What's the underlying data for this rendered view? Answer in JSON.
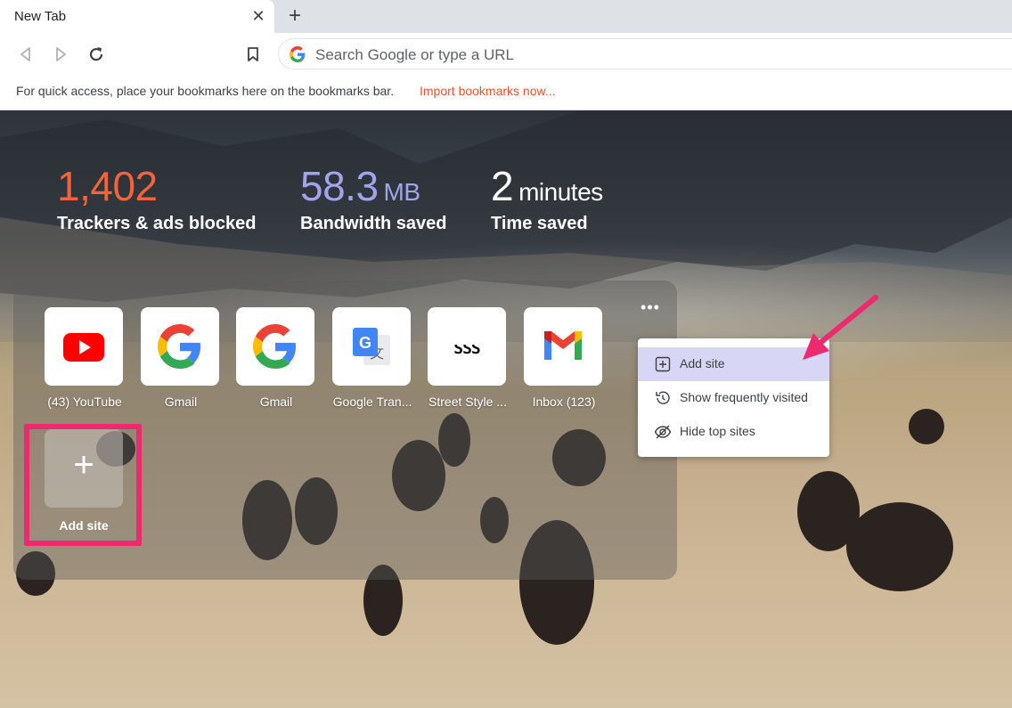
{
  "browser": {
    "tab_title": "New Tab",
    "tab_close": "✕",
    "new_tab": "+",
    "omnibox_placeholder": "Search Google or type a URL",
    "bookmarks_bar_text": "For quick access, place your bookmarks here on the bookmarks bar.",
    "bookmarks_bar_link": "Import bookmarks now..."
  },
  "stats": [
    {
      "value": "1,402",
      "unit": "",
      "label": "Trackers & ads blocked",
      "color": "#f4633a"
    },
    {
      "value": "58.3",
      "unit": "MB",
      "label": "Bandwidth saved",
      "color": "#a0a5eb"
    },
    {
      "value": "2",
      "unit": "minutes",
      "label": "Time saved",
      "color": "#ffffff"
    }
  ],
  "top_sites": {
    "more_button": "•••",
    "tiles": [
      {
        "label": "(43) YouTube",
        "icon": "youtube-icon"
      },
      {
        "label": "Gmail",
        "icon": "google-icon"
      },
      {
        "label": "Gmail",
        "icon": "google-icon"
      },
      {
        "label": "Google Tran...",
        "icon": "google-translate-icon"
      },
      {
        "label": "Street Style ...",
        "icon": "street-style-icon"
      },
      {
        "label": "Inbox (123)",
        "icon": "gmail-icon"
      }
    ],
    "add_site": {
      "label": "Add site",
      "plus": "+"
    }
  },
  "context_menu": {
    "items": [
      {
        "label": "Add site",
        "icon": "add-box-icon",
        "active": true
      },
      {
        "label": "Show frequently visited",
        "icon": "history-icon",
        "active": false
      },
      {
        "label": "Hide top sites",
        "icon": "eye-off-icon",
        "active": false
      }
    ]
  },
  "colors": {
    "highlight": "#ee2a6e",
    "link": "#e8552f",
    "menu_active": "#d8d6f5"
  }
}
